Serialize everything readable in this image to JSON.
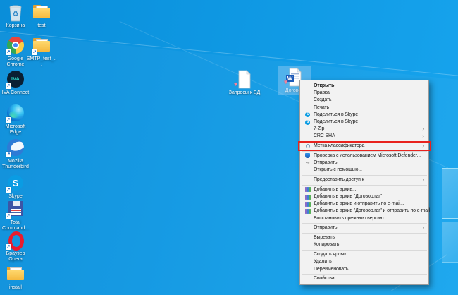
{
  "desktop": {
    "icons": [
      {
        "label": "Корзина",
        "icon": "recycle-bin-icon"
      },
      {
        "label": "test",
        "icon": "folder-icon"
      },
      {
        "label": "Google Chrome",
        "icon": "chrome-icon",
        "shortcut": true
      },
      {
        "label": "SMTP_test_...",
        "icon": "folder-icon",
        "shortcut": true
      },
      {
        "label": "IVA Connect",
        "icon": "iva-connect-icon",
        "shortcut": true
      },
      {
        "label": "Microsoft Edge",
        "icon": "edge-icon",
        "shortcut": true
      },
      {
        "label": "Mozilla Thunderbird",
        "icon": "thunderbird-icon",
        "shortcut": true
      },
      {
        "label": "Skype",
        "icon": "skype-icon",
        "shortcut": true
      },
      {
        "label": "Total Command...",
        "icon": "total-commander-icon",
        "shortcut": true
      },
      {
        "label": "Браузер Opera",
        "icon": "opera-icon",
        "shortcut": true
      },
      {
        "label": "install",
        "icon": "folder-icon"
      }
    ],
    "files": [
      {
        "label": "Запросы к БД",
        "icon": "document-icon",
        "badge": "classifier-heart-badge"
      },
      {
        "label": "Договор",
        "icon": "word-document-icon",
        "badge": "classifier-heart-badge",
        "selected": true
      }
    ],
    "glyphs": {
      "skype_letter": "S",
      "iva_text": "IVA",
      "word_letter": "W",
      "recycle_symbol": "♻",
      "heart_badge": "♥",
      "shortcut_arrow": "↗"
    }
  },
  "context_menu": {
    "submenu_arrow": "›",
    "share_glyph": "↪",
    "highlight_color": "#e8231e",
    "items": [
      {
        "label": "Открыть",
        "bold": true
      },
      {
        "label": "Правка"
      },
      {
        "label": "Создать"
      },
      {
        "label": "Печать"
      },
      {
        "label": "Поделиться в Skype",
        "icon": "skype-icon"
      },
      {
        "label": "Поделиться в Skype",
        "icon": "skype-icon"
      },
      {
        "label": "7-Zip",
        "submenu": true
      },
      {
        "label": "CRC SHA",
        "submenu": true
      },
      {
        "label": "Метка классификатора",
        "icon": "classifier-label-icon",
        "submenu": true,
        "highlighted": true
      },
      {
        "label": "Проверка с использованием Microsoft Defender...",
        "icon": "defender-icon"
      },
      {
        "label": "Отправить",
        "icon": "share-icon"
      },
      {
        "label": "Открыть с помощью..."
      },
      {
        "label": "Предоставить доступ к",
        "submenu": true
      },
      {
        "label": "Добавить в архив...",
        "icon": "winrar-icon"
      },
      {
        "label": "Добавить в архив \"Договор.rar\"",
        "icon": "winrar-icon"
      },
      {
        "label": "Добавить в архив и отправить по e-mail...",
        "icon": "winrar-icon"
      },
      {
        "label": "Добавить в архив \"Договор.rar\" и отправить по e-mail",
        "icon": "winrar-icon"
      },
      {
        "label": "Восстановить прежнюю версию"
      },
      {
        "label": "Отправить",
        "submenu": true
      },
      {
        "label": "Вырезать"
      },
      {
        "label": "Копировать"
      },
      {
        "label": "Создать ярлык"
      },
      {
        "label": "Удалить"
      },
      {
        "label": "Переименовать"
      },
      {
        "label": "Свойства"
      }
    ]
  },
  "colors": {
    "wallpaper_base": "#0f9ae4",
    "menu_background": "#f2f2f2",
    "menu_border": "#9b9b9b",
    "selection": "rgba(150,205,245,0.45)"
  }
}
